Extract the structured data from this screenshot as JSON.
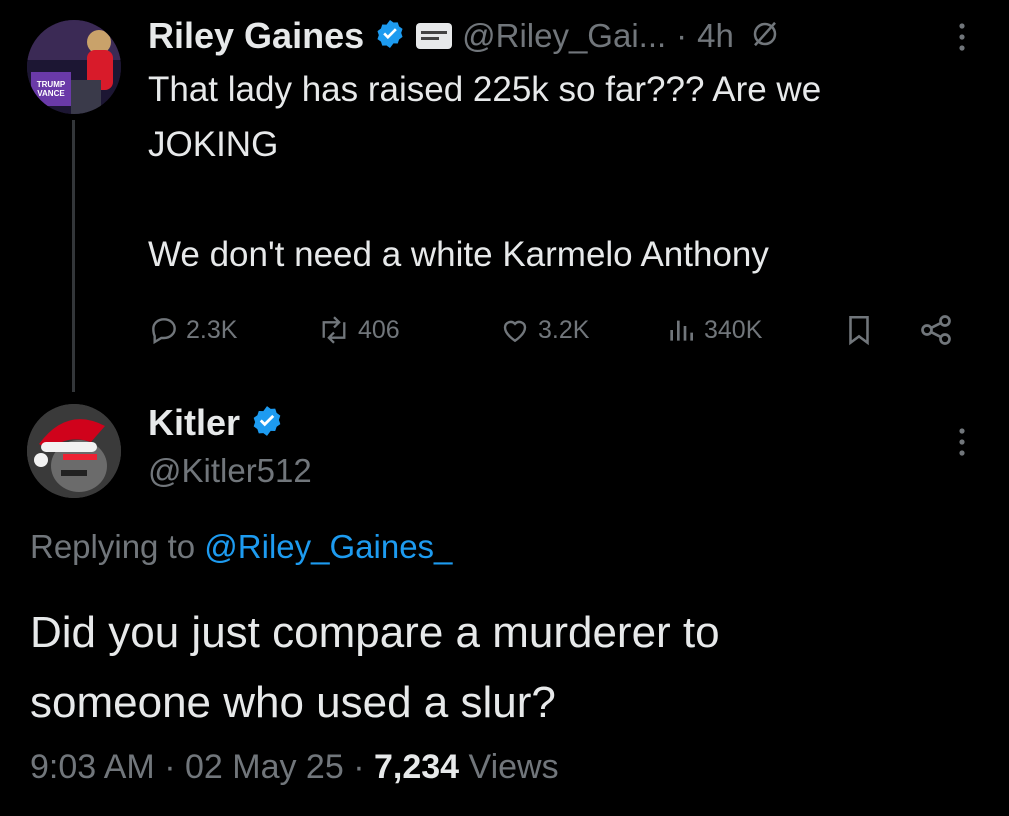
{
  "parent_tweet": {
    "author_name": "Riley Gaines",
    "handle": "@Riley_Gai...",
    "separator": "·",
    "time": "4h",
    "text": "That lady has raised 225k so far??? Are we\nJOKING\n\nWe don't need a white Karmelo Anthony",
    "avatar_sign_text": "TRUMP VANCE",
    "stats": {
      "replies": "2.3K",
      "reposts": "406",
      "likes": "3.2K",
      "views": "340K"
    }
  },
  "reply_tweet": {
    "author_name": "Kitler",
    "handle": "@Kitler512",
    "replying_prefix": "Replying to",
    "replying_handle": "@Riley_Gaines_",
    "text": "Did you just compare a murderer to\nsomeone who used a slur?",
    "time": "9:03 AM",
    "date": "02 May 25",
    "views_count": "7,234",
    "views_label": "Views"
  },
  "colors": {
    "background": "#000000",
    "text": "#e7e9ea",
    "muted": "#71767b",
    "link": "#1d9bf0",
    "verified": "#1d9bf0"
  }
}
